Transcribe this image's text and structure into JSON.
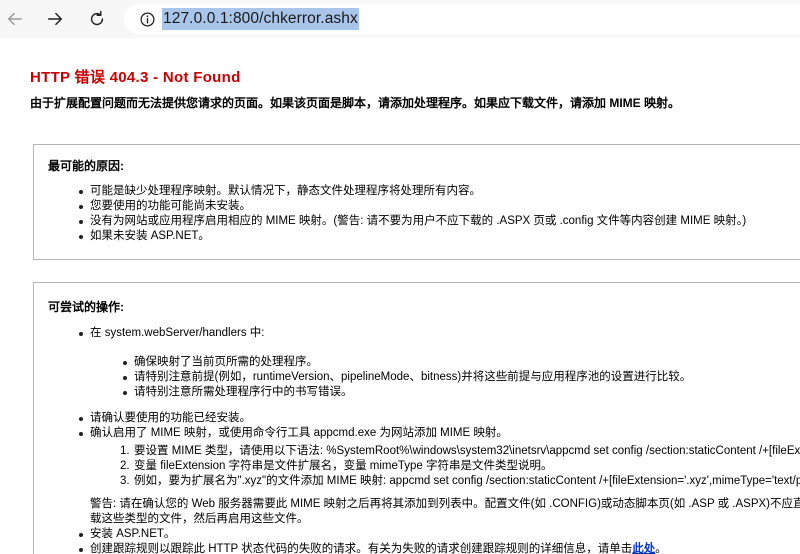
{
  "browser": {
    "url": "127.0.0.1:800/chkerror.ashx"
  },
  "page": {
    "title": "HTTP 错误 404.3 - Not Found",
    "subtitle": "由于扩展配置问题而无法提供您请求的页面。如果该页面是脚本，请添加处理程序。如果应下载文件，请添加 MIME 映射。"
  },
  "causes": {
    "heading": "最可能的原因:",
    "items": [
      "可能是缺少处理程序映射。默认情况下，静态文件处理程序将处理所有内容。",
      "您要使用的功能可能尚未安装。",
      "没有为网站或应用程序启用相应的 MIME 映射。(警告: 请不要为用户不应下载的 .ASPX 页或 .config 文件等内容创建 MIME 映射。)",
      "如果未安装 ASP.NET。"
    ]
  },
  "actions": {
    "heading": "可尝试的操作:",
    "item1": "在 system.webServer/handlers 中:",
    "sub": [
      "确保映射了当前页所需的处理程序。",
      "请特别注意前提(例如，runtimeVersion、pipelineMode、bitness)并将这些前提与应用程序池的设置进行比较。",
      "请特别注意所需处理程序行中的书写错误。"
    ],
    "item2": "请确认要使用的功能已经安装。",
    "item3": "确认启用了 MIME 映射，或使用命令行工具 appcmd.exe 为网站添加 MIME 映射。",
    "steps": [
      {
        "num": "1.",
        "text": "要设置 MIME 类型，请使用以下语法: %SystemRoot%\\windows\\system32\\inetsrv\\appcmd set config /section:staticContent /+[fileExtension='string',mimeType='string']"
      },
      {
        "num": "2.",
        "text": "变量 fileExtension 字符串是文件扩展名，变量 mimeType 字符串是文件类型说明。"
      },
      {
        "num": "3.",
        "text": "例如，要为扩展名为\".xyz\"的文件添加 MIME 映射: appcmd set config /section:staticContent /+[fileExtension='.xyz',mimeType='text/plain']"
      }
    ],
    "warning_line1": "警告: 请在确认您的 Web 服务器需要此 MIME 映射之后再将其添加到列表中。配置文件(如 .CONFIG)或动态脚本页(如 .ASP 或 .ASPX)不应直接下载，且应始终通过处理程序进行处理。其他文件(如数据库文件或用于存储配置的文件，如 .XML 或 .MDF)有时用于存储配置信息。请确定客户端是否能下",
    "warning_line2": "载这些类型的文件，然后再启用这些文件。",
    "item4": "安装 ASP.NET。",
    "item5": "创建跟踪规则以跟踪此 HTTP 状态代码的失败的请求。有关为失败的请求创建跟踪规则的详细信息，请单击",
    "item5_link": "此处",
    "item5_end": "。"
  }
}
